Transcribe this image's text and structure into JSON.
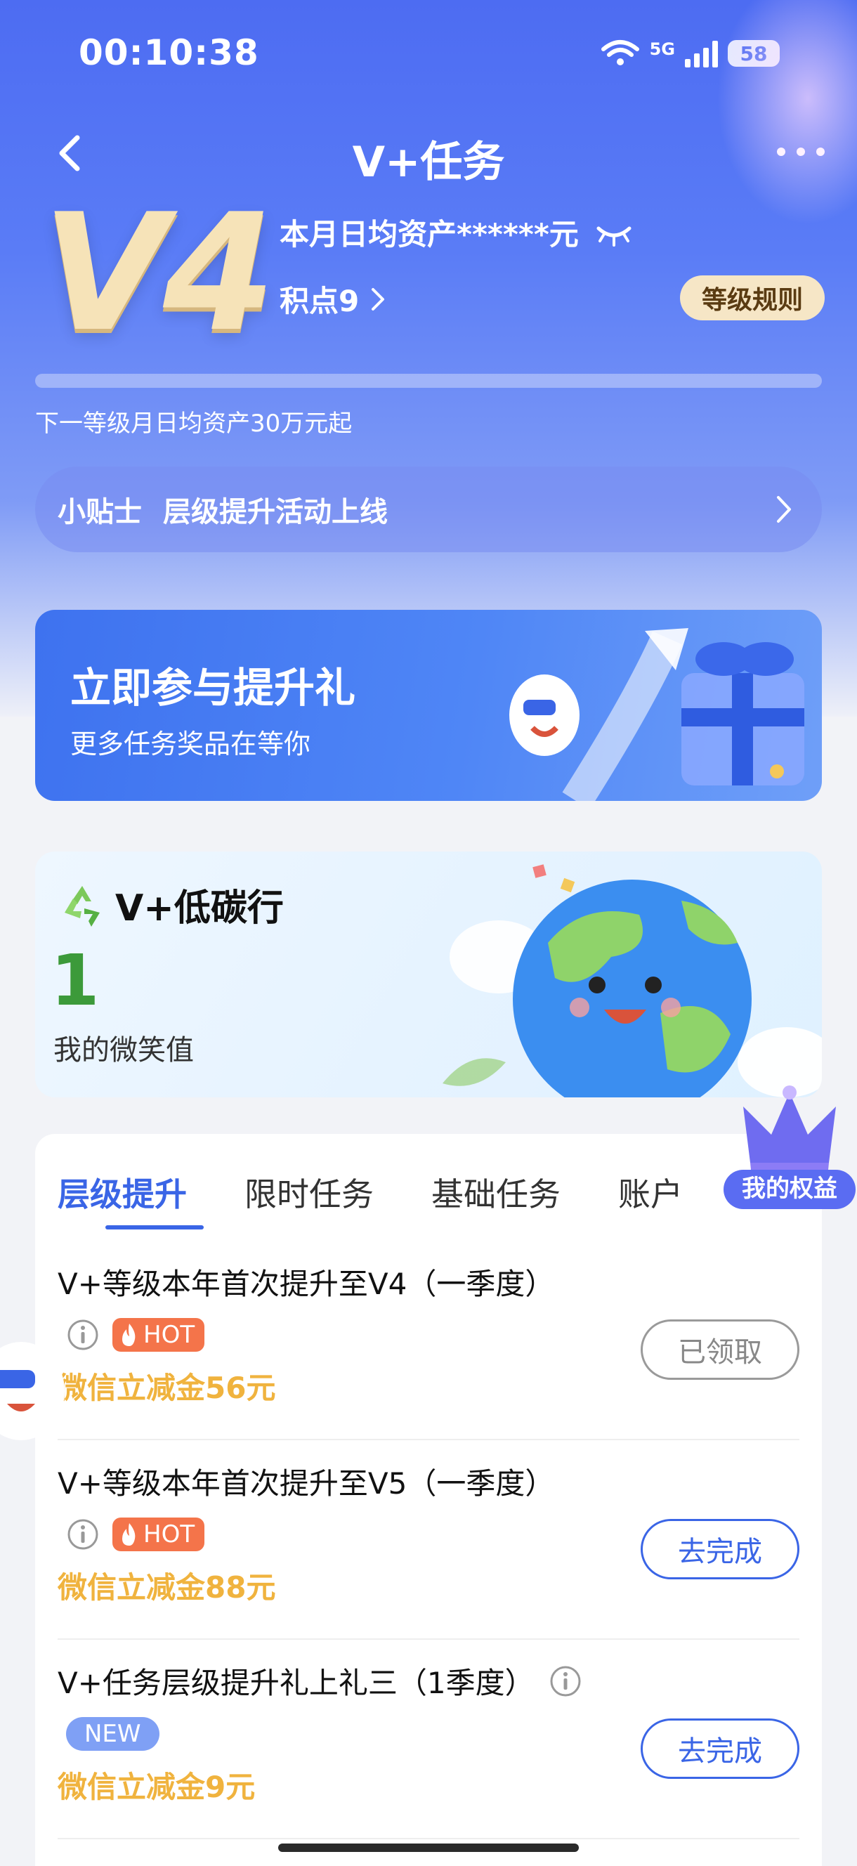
{
  "status_bar": {
    "time": "00:10:38",
    "network": "5G",
    "battery": "58"
  },
  "nav": {
    "title": "V+任务"
  },
  "member": {
    "level": "V4",
    "assets_text": "本月日均资产******元",
    "points_text": "积点9",
    "rules_button": "等级规则",
    "progress": 0.0,
    "next_level_text": "下一等级月日均资产30万元起"
  },
  "tips": {
    "label": "小贴士",
    "text": "层级提升活动上线"
  },
  "promo": {
    "title": "立即参与提升礼",
    "subtitle": "更多任务奖品在等你"
  },
  "carbon": {
    "title": "V+低碳行",
    "value": "1",
    "label": "我的微笑值"
  },
  "tabs": [
    {
      "label": "层级提升",
      "active": true
    },
    {
      "label": "限时任务",
      "active": false
    },
    {
      "label": "基础任务",
      "active": false
    },
    {
      "label": "账户",
      "active": false
    }
  ],
  "floating": {
    "benefits_label": "我的权益"
  },
  "tasks": [
    {
      "title": "V+等级本年首次提升至V4（一季度）",
      "tag": "HOT",
      "reward": "微信立减金56元",
      "button": "已领取",
      "button_state": "done"
    },
    {
      "title": "V+等级本年首次提升至V5（一季度）",
      "tag": "HOT",
      "reward": "微信立减金88元",
      "button": "去完成",
      "button_state": "go"
    },
    {
      "title": "V+任务层级提升礼上礼三（1季度）",
      "tag": "NEW",
      "reward": "微信立减金9元",
      "button": "去完成",
      "button_state": "go"
    }
  ],
  "colors": {
    "primary": "#3a65e6",
    "reward": "#f0b33e",
    "hot": "#f4744a",
    "new": "#7fa0f5"
  }
}
